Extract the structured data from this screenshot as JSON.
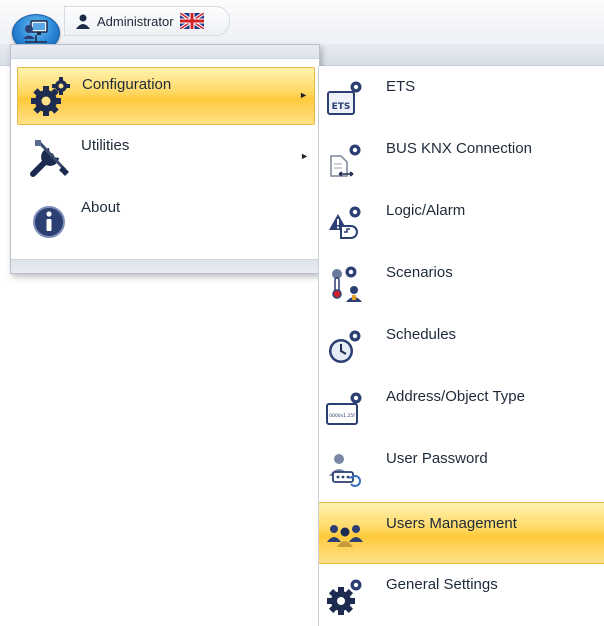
{
  "header": {
    "user_name": "Administrator",
    "app_icon": "computer-network-icon",
    "user_icon": "user-icon",
    "flag_icon": "uk-flag-icon"
  },
  "main_menu": {
    "items": [
      {
        "label": "Configuration",
        "icon": "gears-icon",
        "has_submenu": true,
        "selected": true
      },
      {
        "label": "Utilities",
        "icon": "tools-icon",
        "has_submenu": true,
        "selected": false
      },
      {
        "label": "About",
        "icon": "info-icon",
        "has_submenu": false,
        "selected": false
      }
    ]
  },
  "submenu": {
    "items": [
      {
        "label": "ETS",
        "icon": "ets-icon"
      },
      {
        "label": "BUS KNX Connection",
        "icon": "bus-connection-icon"
      },
      {
        "label": "Logic/Alarm",
        "icon": "logic-alarm-icon"
      },
      {
        "label": "Scenarios",
        "icon": "scenarios-icon"
      },
      {
        "label": "Schedules",
        "icon": "schedules-icon"
      },
      {
        "label": "Address/Object Type",
        "icon": "address-object-type-icon",
        "icon_text": "0000x1.25f"
      },
      {
        "label": "User Password",
        "icon": "user-password-icon"
      },
      {
        "label": "Users Management",
        "icon": "users-management-icon",
        "selected": true
      },
      {
        "label": "General Settings",
        "icon": "general-settings-icon"
      }
    ],
    "ets_icon_text": "ETS"
  },
  "colors": {
    "selection_gold": "#ffc93a",
    "icon_navy": "#2b3f73",
    "app_blue": "#2a86d6"
  }
}
